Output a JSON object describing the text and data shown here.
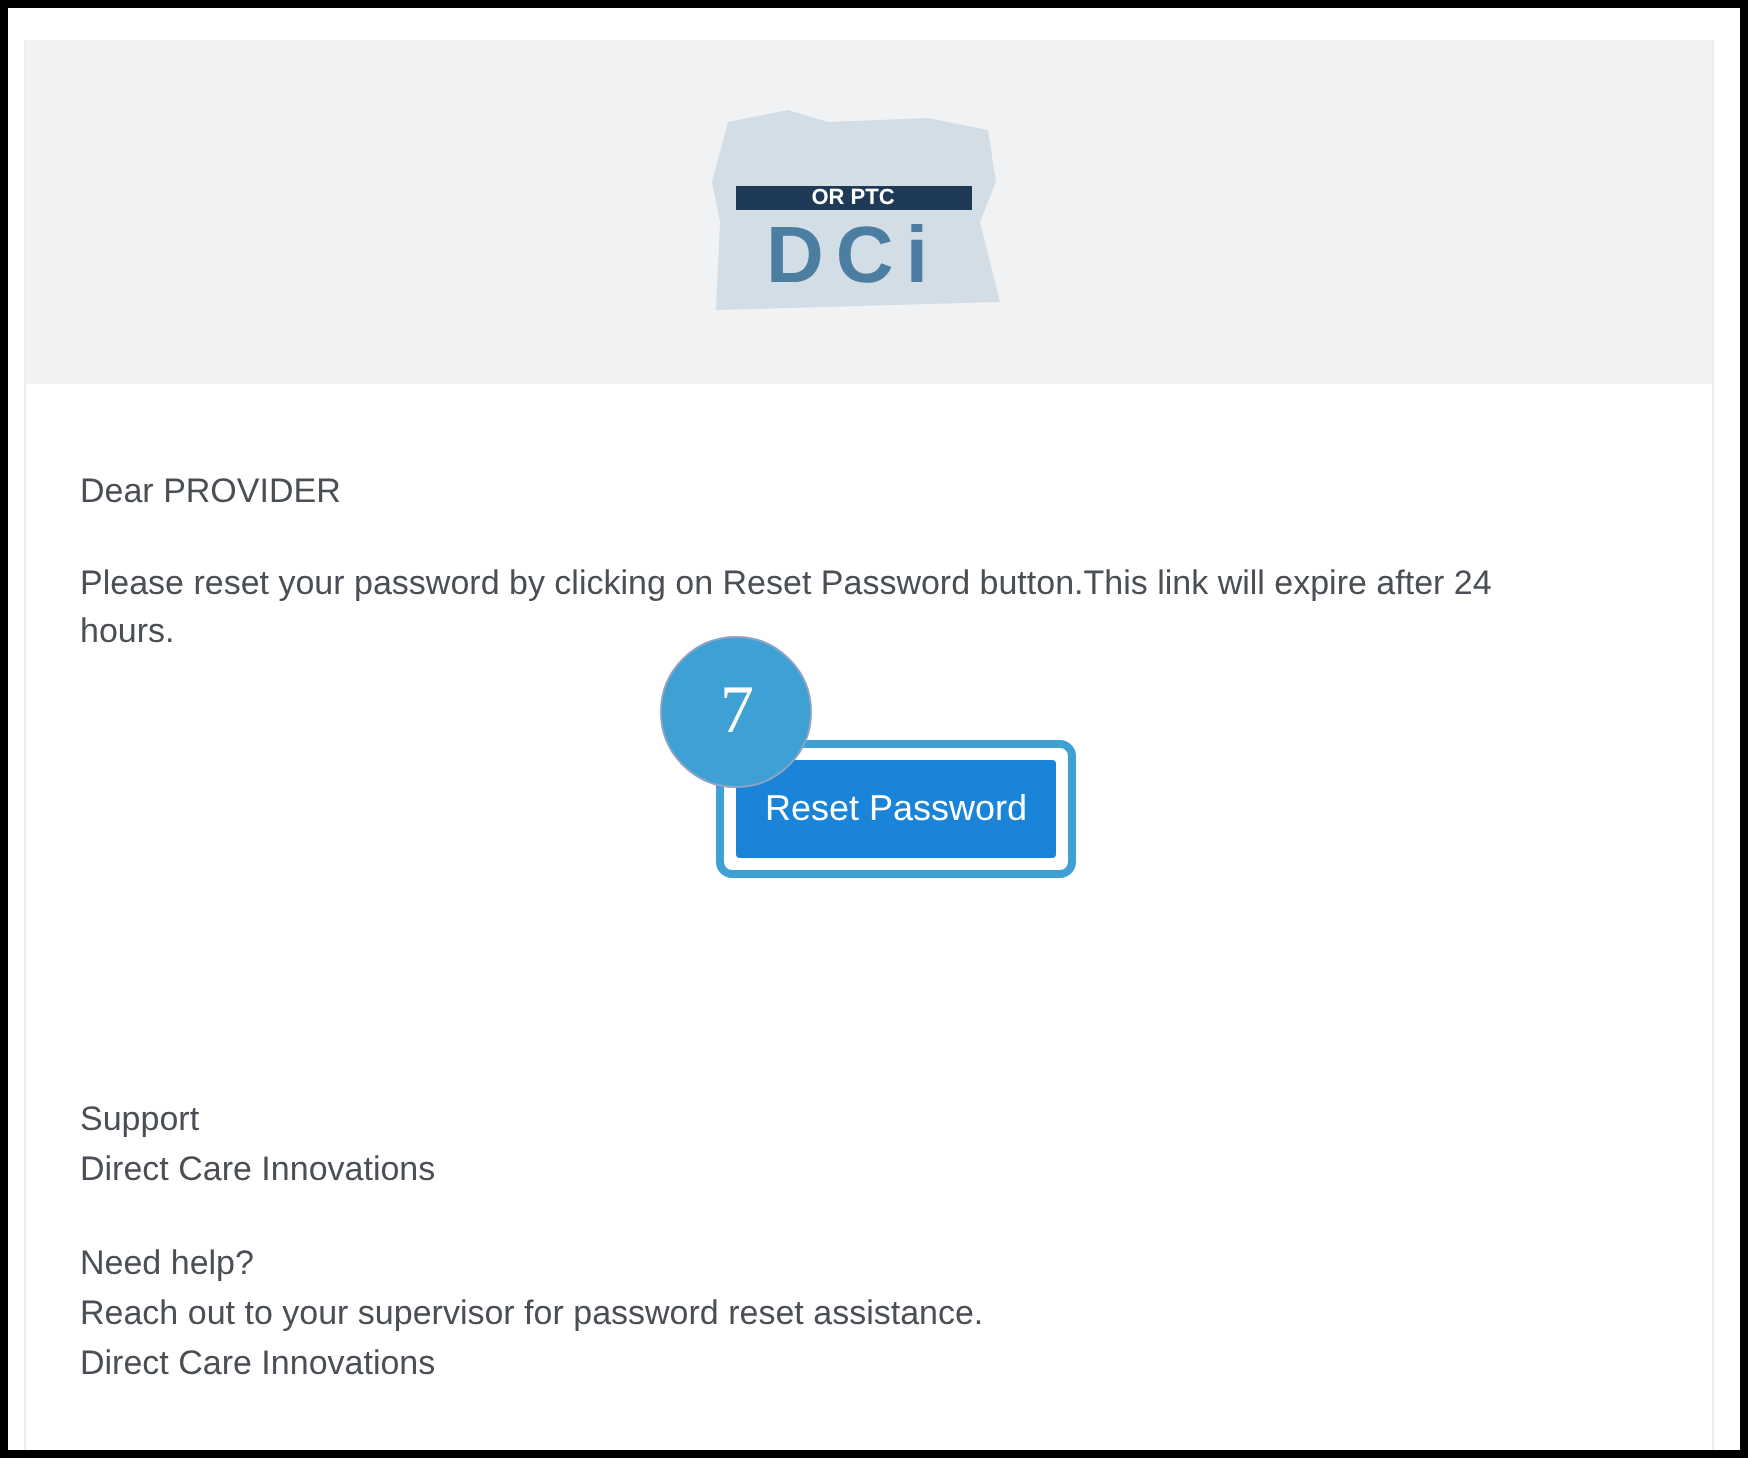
{
  "header": {
    "logo": {
      "caption": "OR PTC",
      "mark": "DCi"
    }
  },
  "email": {
    "greeting": "Dear PROVIDER",
    "message": "Please reset your password by clicking on Reset Password button.This link will expire after 24 hours.",
    "button": {
      "label": "Reset Password",
      "highlighted": true
    },
    "callout": {
      "number": "7"
    },
    "signature": [
      "Support",
      "Direct Care Innovations"
    ],
    "help": [
      "Need help?",
      "Reach out to your supervisor for password reset assistance.",
      "Direct Care Innovations"
    ]
  }
}
